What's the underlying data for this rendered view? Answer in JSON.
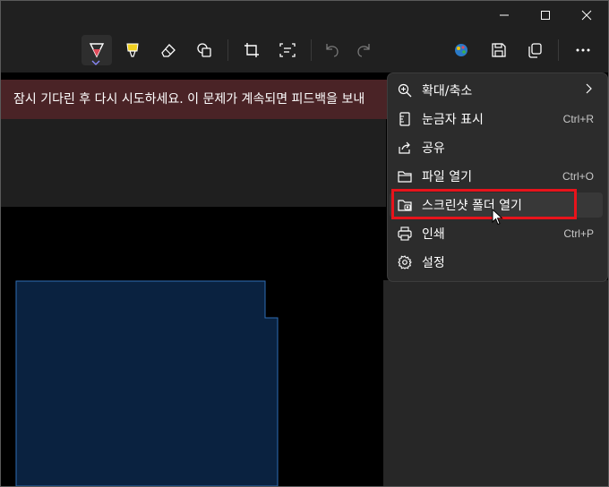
{
  "window_controls": {
    "minimize_icon": "minimize-icon",
    "maximize_icon": "maximize-icon",
    "close_icon": "close-icon"
  },
  "toolbar": {
    "tools": [
      "ballpoint-pen-icon",
      "highlighter-icon",
      "eraser-icon",
      "shapes-icon",
      "crop-icon",
      "text-actions-icon",
      "undo-icon",
      "redo-icon",
      "paint-icon",
      "save-icon",
      "copy-icon",
      "more-icon"
    ],
    "accent_color": "#e04a5a"
  },
  "banner": {
    "text": "잠시 기다린 후 다시 시도하세요. 이 문제가 계속되면 피드백을 보내",
    "color": "#4a2326"
  },
  "canvas": {
    "shape_fill": "#0a2240",
    "shape_border": "#2f6db3"
  },
  "menu": {
    "items": [
      {
        "label": "확대/축소",
        "shortcut": "",
        "icon": "zoom-icon",
        "submenu": true
      },
      {
        "label": "눈금자 표시",
        "shortcut": "Ctrl+R",
        "icon": "ruler-icon"
      },
      {
        "label": "공유",
        "shortcut": "",
        "icon": "share-icon"
      },
      {
        "label": "파일 열기",
        "shortcut": "Ctrl+O",
        "icon": "folder-icon"
      },
      {
        "label": "스크린샷 폴더 열기",
        "shortcut": "",
        "icon": "screenshot-folder-icon"
      },
      {
        "label": "인쇄",
        "shortcut": "Ctrl+P",
        "icon": "printer-icon"
      },
      {
        "label": "설정",
        "shortcut": "",
        "icon": "gear-icon"
      }
    ],
    "highlight_color": "#e8131b"
  }
}
